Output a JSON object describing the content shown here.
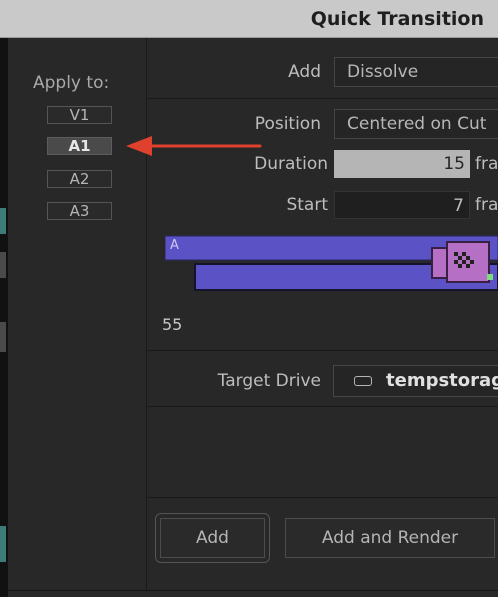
{
  "window": {
    "title": "Quick Transition"
  },
  "apply_to": {
    "label": "Apply to:",
    "tracks": [
      {
        "label": "V1",
        "selected": false
      },
      {
        "label": "A1",
        "selected": true
      },
      {
        "label": "A2",
        "selected": false
      },
      {
        "label": "A3",
        "selected": false
      }
    ]
  },
  "form": {
    "add_label": "Add",
    "add_value": "Dissolve",
    "position_label": "Position",
    "position_value": "Centered on Cut",
    "duration_label": "Duration",
    "duration_value": "15",
    "duration_unit": "fra",
    "start_label": "Start",
    "start_value": "7",
    "start_unit": "fra"
  },
  "timeline": {
    "clip_letter": "A",
    "frame_count": "55"
  },
  "target_drive": {
    "label": "Target Drive",
    "value": "tempstorag"
  },
  "buttons": {
    "add": "Add",
    "add_and_render": "Add and Render"
  },
  "colors": {
    "clip_fill": "#5b52c6",
    "transition_fill": "#b56fc5",
    "arrow": "#e0412c",
    "accent_green": "#7ddc7d"
  }
}
